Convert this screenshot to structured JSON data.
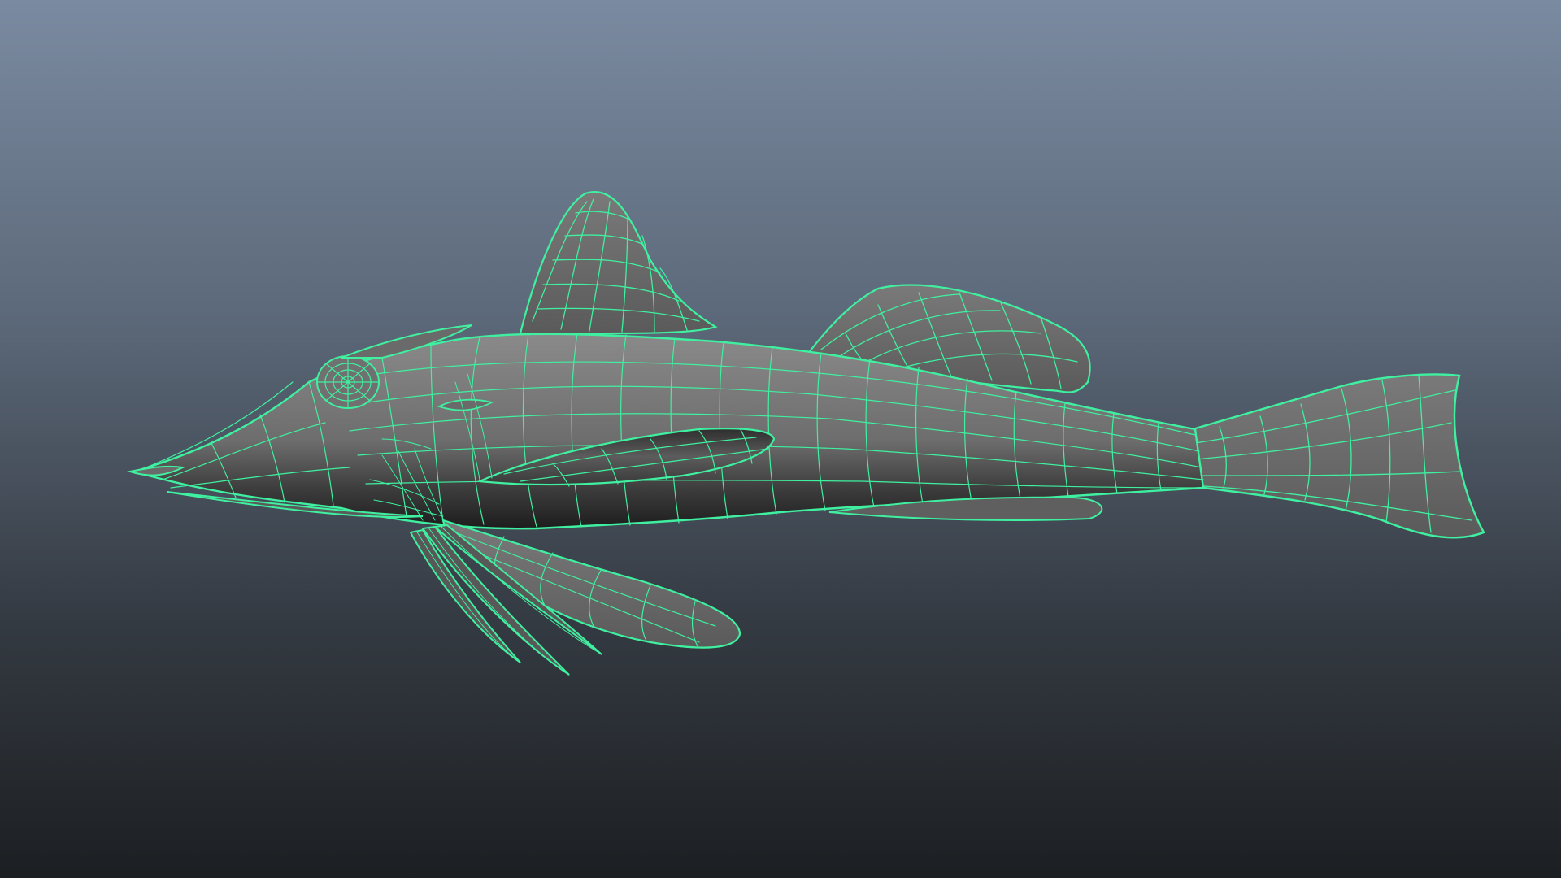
{
  "viewport": {
    "background_top": "#7a8aa0",
    "background_bottom": "#1c1f22",
    "display_mode": "wireframe-on-shaded"
  },
  "model": {
    "subject": "gurnard-fish",
    "surface_color": "#6d6d6d",
    "surface_shadow": "#2a2a2a",
    "wireframe_color": "#3ff0a0"
  }
}
